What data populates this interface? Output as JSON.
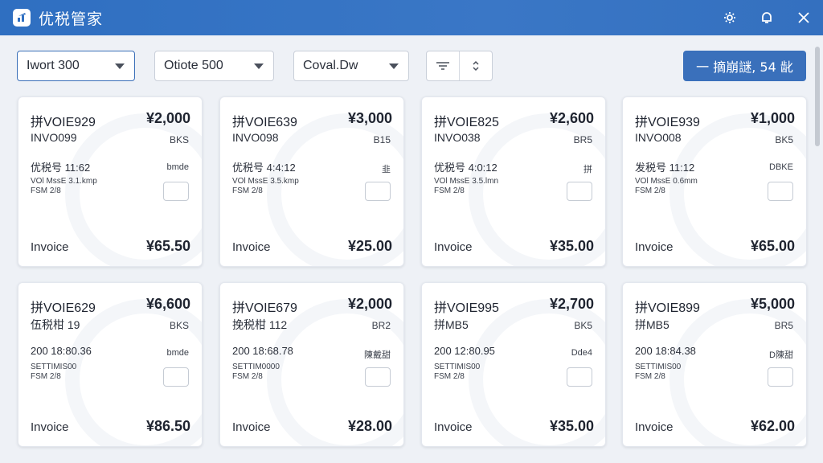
{
  "app": {
    "title": "优税管家",
    "icons": {
      "logo": "app-logo-icon",
      "settings": "gear-icon",
      "notify": "bell-icon",
      "close": "close-icon"
    }
  },
  "toolbar": {
    "filter1": "Iwort 300",
    "filter2": "Otiote 500",
    "filter3": "Coval.Dw",
    "primary_button": "一 摘崩謎, 54 龀"
  },
  "cards": [
    {
      "title": "拼VOIE929",
      "amount": "¥2,000",
      "sub": "INVO099",
      "tag": "BKS",
      "line1": "优税号 11:62",
      "tag2": "bmde",
      "line2": "VOl MssE 3.1.kmp",
      "line3": "FSM 2/8",
      "type": "Invoice",
      "total": "¥65.50"
    },
    {
      "title": "拼VOIE639",
      "amount": "¥3,000",
      "sub": "INVO098",
      "tag": "B15",
      "line1": "优税号 4:4:12",
      "tag2": "韭",
      "line2": "VOl MssE 3.5.kmp",
      "line3": "FSM 2/8",
      "type": "Invoice",
      "total": "¥25.00"
    },
    {
      "title": "拼VOIE825",
      "amount": "¥2,600",
      "sub": "INVO038",
      "tag": "BR5",
      "line1": "优税号 4:0:12",
      "tag2": "拼",
      "line2": "VOl MssE 3.5.lmn",
      "line3": "FSM 2/8",
      "type": "Invoice",
      "total": "¥35.00"
    },
    {
      "title": "拼VOIE939",
      "amount": "¥1,000",
      "sub": "INVO008",
      "tag": "BK5",
      "line1": "发税号 11:12",
      "tag2": "DBKE",
      "line2": "VOl MssE 0.6mm",
      "line3": "FSM 2/8",
      "type": "Invoice",
      "total": "¥65.00"
    },
    {
      "title": "拼VOIE629",
      "amount": "¥6,600",
      "sub": "伍税柑 19",
      "tag": "BKS",
      "line1": "200 18:80.36",
      "tag2": "bmde",
      "line2": "SETTIMIS00",
      "line3": "FSM 2/8",
      "type": "Invoice",
      "total": "¥86.50"
    },
    {
      "title": "拼VOIE679",
      "amount": "¥2,000",
      "sub": "挽税柑 112",
      "tag": "BR2",
      "line1": "200 18:68.78",
      "tag2": "陳戴甜",
      "line2": "SETTIM0000",
      "line3": "FSM 2/8",
      "type": "Invoice",
      "total": "¥28.00"
    },
    {
      "title": "拼VOIE995",
      "amount": "¥2,700",
      "sub": "拼MB5",
      "tag": "BK5",
      "line1": "200 12:80.95",
      "tag2": "Dde4",
      "line2": "SETTIMIS00",
      "line3": "FSM 2/8",
      "type": "Invoice",
      "total": "¥35.00"
    },
    {
      "title": "拼VOIE899",
      "amount": "¥5,000",
      "sub": "拼MB5",
      "tag": "BR5",
      "line1": "200 18:84.38",
      "tag2": "D陳甜",
      "line2": "SETTIMIS00",
      "line3": "FSM 2/8",
      "type": "Invoice",
      "total": "¥62.00"
    }
  ]
}
